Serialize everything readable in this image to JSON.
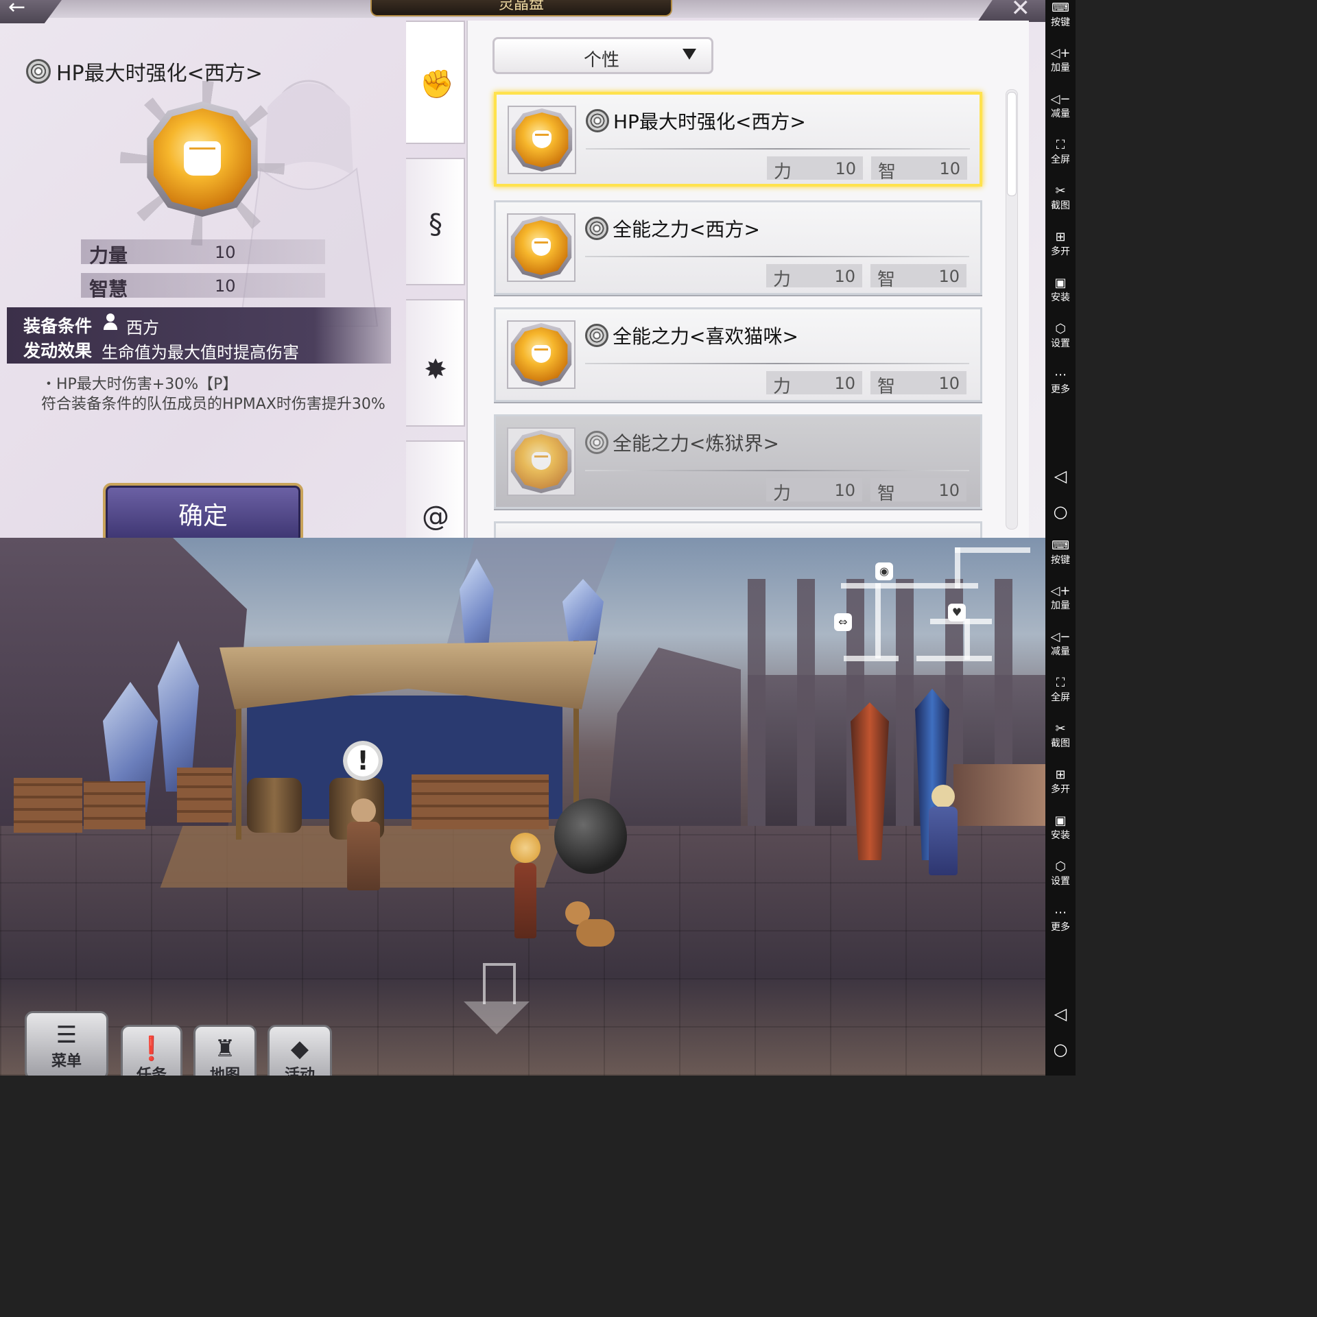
{
  "top": {
    "title": "灵晶盘",
    "back_icon": "back-arrow-icon",
    "close_icon": "close-icon",
    "detail": {
      "title": "HP最大时强化<西方>",
      "stats": [
        {
          "label": "力量",
          "value": "10"
        },
        {
          "label": "智慧",
          "value": "10"
        }
      ],
      "condition_label": "装备条件",
      "condition_value": "西方",
      "effect_label": "发动效果",
      "effect_value": "生命值为最大值时提高伤害",
      "desc_line1": "・HP最大时伤害+30%【P】",
      "desc_line2": "符合装备条件的队伍成员的HPMAX时伤害提升30%",
      "confirm_label": "确定"
    },
    "tabs": [
      {
        "icon": "fist-icon",
        "active": true
      },
      {
        "icon": "swirl-sparkle-icon",
        "active": false
      },
      {
        "icon": "star-burst-icon",
        "active": false
      },
      {
        "icon": "wind-spiral-icon",
        "active": false
      }
    ],
    "filter": {
      "value": "个性"
    },
    "cards": [
      {
        "title": "HP最大时强化<西方>",
        "stat1_k": "力",
        "stat1_v": "10",
        "stat2_k": "智",
        "stat2_v": "10",
        "selected": true,
        "dim": false
      },
      {
        "title": "全能之力<西方>",
        "stat1_k": "力",
        "stat1_v": "10",
        "stat2_k": "智",
        "stat2_v": "10",
        "selected": false,
        "dim": false
      },
      {
        "title": "全能之力<喜欢猫咪>",
        "stat1_k": "力",
        "stat1_v": "10",
        "stat2_k": "智",
        "stat2_v": "10",
        "selected": false,
        "dim": false
      },
      {
        "title": "全能之力<炼狱界>",
        "stat1_k": "力",
        "stat1_v": "10",
        "stat2_k": "智",
        "stat2_v": "10",
        "selected": false,
        "dim": true
      }
    ]
  },
  "sidebar": {
    "items": [
      {
        "icon": "keyboard-icon",
        "label": "按键"
      },
      {
        "icon": "volume-up-icon",
        "label": "加量"
      },
      {
        "icon": "volume-down-icon",
        "label": "减量"
      },
      {
        "icon": "fullscreen-icon",
        "label": "全屏"
      },
      {
        "icon": "scissors-icon",
        "label": "截图"
      },
      {
        "icon": "multi-window-icon",
        "label": "多开"
      },
      {
        "icon": "apk-install-icon",
        "label": "安装"
      },
      {
        "icon": "settings-icon",
        "label": "设置"
      },
      {
        "icon": "more-icon",
        "label": "更多"
      }
    ],
    "nav": [
      {
        "icon": "back-triangle-icon"
      },
      {
        "icon": "home-circle-icon"
      }
    ]
  },
  "scene": {
    "menu": [
      {
        "icon": "scroll-icon",
        "label": "菜单"
      },
      {
        "icon": "quest-icon",
        "label": "任务"
      },
      {
        "icon": "map-icon",
        "label": "地图"
      },
      {
        "icon": "crystal-icon",
        "label": "活动"
      }
    ],
    "quest_marker": "!"
  }
}
